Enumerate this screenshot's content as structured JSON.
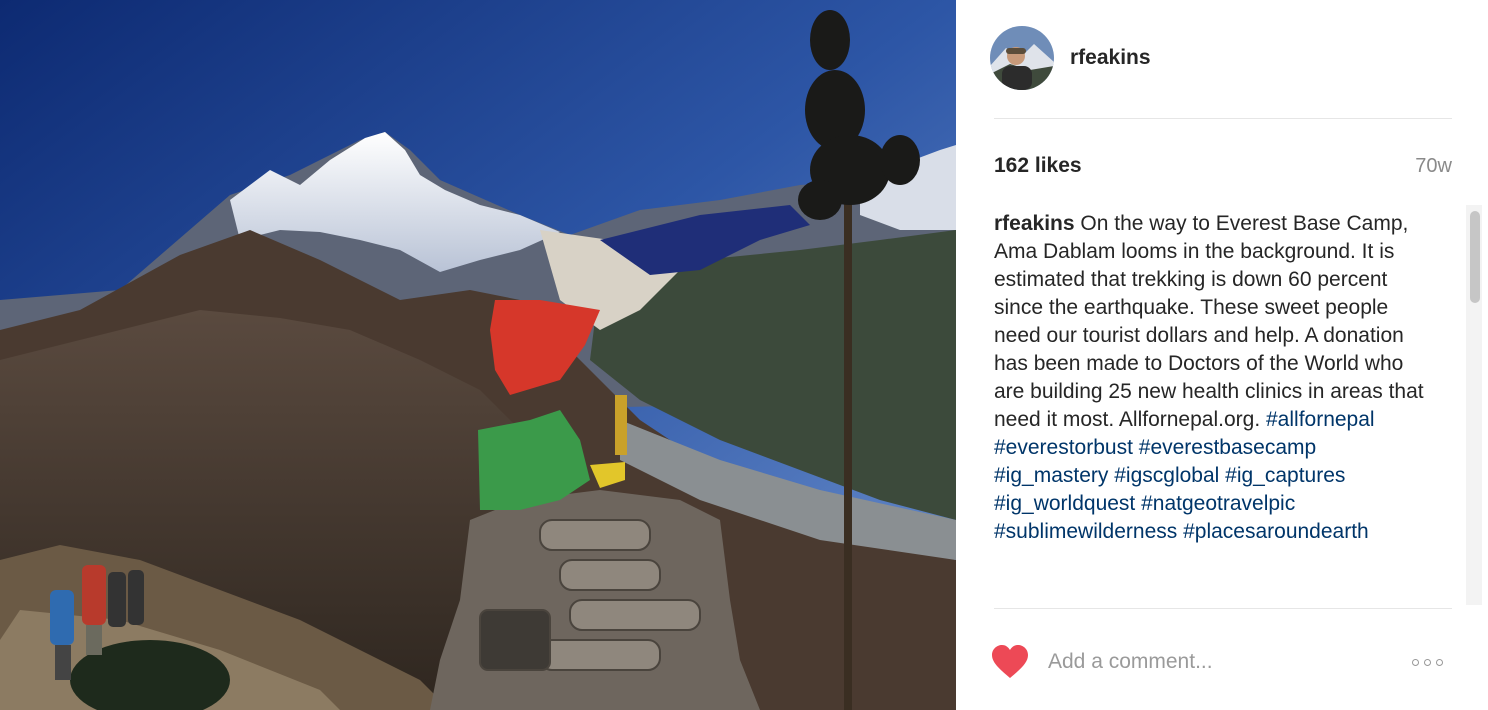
{
  "post": {
    "username": "rfeakins",
    "likes": "162 likes",
    "time_ago": "70w",
    "caption_user": "rfeakins",
    "caption_text": "On the way to Everest Base Camp, Ama Dablam looms in the background. It is estimated that trekking is down 60 percent since the earthquake. These sweet people need our tourist dollars and help. A donation has been made to Doctors of the World who are building 25 new health clinics in areas that need it most. Allfornepal.org.",
    "hashtags": [
      "#allfornepal",
      "#everestorbust",
      "#everestbasecamp",
      "#ig_mastery",
      "#igscglobal",
      "#ig_captures",
      "#ig_worldquest",
      "#natgeotravelpic",
      "#sublimewilderness",
      "#placesaroundearth"
    ]
  },
  "comment": {
    "placeholder": "Add a comment..."
  },
  "icons": {
    "like": "heart-icon",
    "more": "more-options-icon"
  },
  "colors": {
    "text": "#262626",
    "hashtag": "#003569",
    "muted": "#8a8a8a",
    "heart": "#ed4956"
  }
}
